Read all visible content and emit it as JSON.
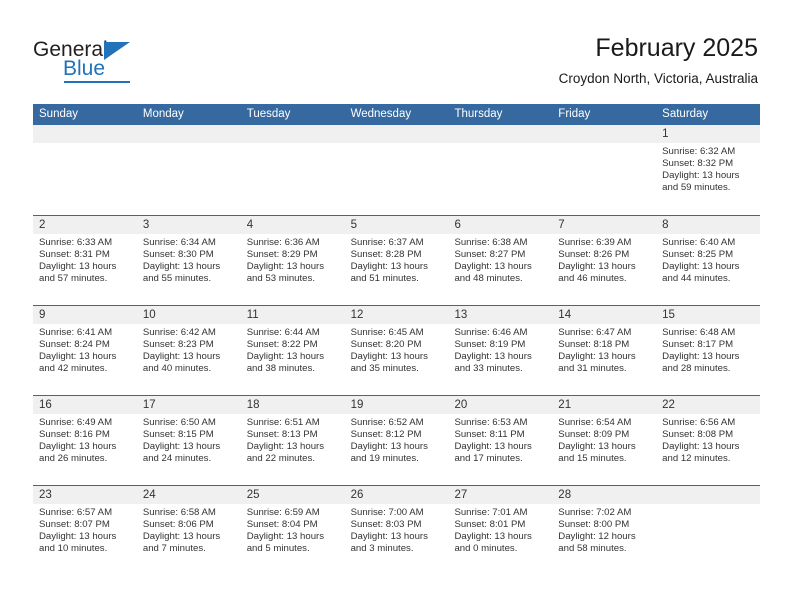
{
  "brand": {
    "name_top": "General",
    "name_bottom": "Blue",
    "accent_color": "#2272b9"
  },
  "header": {
    "title": "February 2025",
    "location": "Croydon North, Victoria, Australia"
  },
  "theme": {
    "header_bar": "#36699f",
    "day_band": "#f0f0f0",
    "text": "#333333"
  },
  "calendar": {
    "weekdays": [
      "Sunday",
      "Monday",
      "Tuesday",
      "Wednesday",
      "Thursday",
      "Friday",
      "Saturday"
    ],
    "labels": {
      "sunrise": "Sunrise:",
      "sunset": "Sunset:",
      "daylight": "Daylight:"
    },
    "weeks": [
      [
        {
          "day": ""
        },
        {
          "day": ""
        },
        {
          "day": ""
        },
        {
          "day": ""
        },
        {
          "day": ""
        },
        {
          "day": ""
        },
        {
          "day": "1",
          "sunrise": "Sunrise: 6:32 AM",
          "sunset": "Sunset: 8:32 PM",
          "daylight1": "Daylight: 13 hours",
          "daylight2": "and 59 minutes."
        }
      ],
      [
        {
          "day": "2",
          "sunrise": "Sunrise: 6:33 AM",
          "sunset": "Sunset: 8:31 PM",
          "daylight1": "Daylight: 13 hours",
          "daylight2": "and 57 minutes."
        },
        {
          "day": "3",
          "sunrise": "Sunrise: 6:34 AM",
          "sunset": "Sunset: 8:30 PM",
          "daylight1": "Daylight: 13 hours",
          "daylight2": "and 55 minutes."
        },
        {
          "day": "4",
          "sunrise": "Sunrise: 6:36 AM",
          "sunset": "Sunset: 8:29 PM",
          "daylight1": "Daylight: 13 hours",
          "daylight2": "and 53 minutes."
        },
        {
          "day": "5",
          "sunrise": "Sunrise: 6:37 AM",
          "sunset": "Sunset: 8:28 PM",
          "daylight1": "Daylight: 13 hours",
          "daylight2": "and 51 minutes."
        },
        {
          "day": "6",
          "sunrise": "Sunrise: 6:38 AM",
          "sunset": "Sunset: 8:27 PM",
          "daylight1": "Daylight: 13 hours",
          "daylight2": "and 48 minutes."
        },
        {
          "day": "7",
          "sunrise": "Sunrise: 6:39 AM",
          "sunset": "Sunset: 8:26 PM",
          "daylight1": "Daylight: 13 hours",
          "daylight2": "and 46 minutes."
        },
        {
          "day": "8",
          "sunrise": "Sunrise: 6:40 AM",
          "sunset": "Sunset: 8:25 PM",
          "daylight1": "Daylight: 13 hours",
          "daylight2": "and 44 minutes."
        }
      ],
      [
        {
          "day": "9",
          "sunrise": "Sunrise: 6:41 AM",
          "sunset": "Sunset: 8:24 PM",
          "daylight1": "Daylight: 13 hours",
          "daylight2": "and 42 minutes."
        },
        {
          "day": "10",
          "sunrise": "Sunrise: 6:42 AM",
          "sunset": "Sunset: 8:23 PM",
          "daylight1": "Daylight: 13 hours",
          "daylight2": "and 40 minutes."
        },
        {
          "day": "11",
          "sunrise": "Sunrise: 6:44 AM",
          "sunset": "Sunset: 8:22 PM",
          "daylight1": "Daylight: 13 hours",
          "daylight2": "and 38 minutes."
        },
        {
          "day": "12",
          "sunrise": "Sunrise: 6:45 AM",
          "sunset": "Sunset: 8:20 PM",
          "daylight1": "Daylight: 13 hours",
          "daylight2": "and 35 minutes."
        },
        {
          "day": "13",
          "sunrise": "Sunrise: 6:46 AM",
          "sunset": "Sunset: 8:19 PM",
          "daylight1": "Daylight: 13 hours",
          "daylight2": "and 33 minutes."
        },
        {
          "day": "14",
          "sunrise": "Sunrise: 6:47 AM",
          "sunset": "Sunset: 8:18 PM",
          "daylight1": "Daylight: 13 hours",
          "daylight2": "and 31 minutes."
        },
        {
          "day": "15",
          "sunrise": "Sunrise: 6:48 AM",
          "sunset": "Sunset: 8:17 PM",
          "daylight1": "Daylight: 13 hours",
          "daylight2": "and 28 minutes."
        }
      ],
      [
        {
          "day": "16",
          "sunrise": "Sunrise: 6:49 AM",
          "sunset": "Sunset: 8:16 PM",
          "daylight1": "Daylight: 13 hours",
          "daylight2": "and 26 minutes."
        },
        {
          "day": "17",
          "sunrise": "Sunrise: 6:50 AM",
          "sunset": "Sunset: 8:15 PM",
          "daylight1": "Daylight: 13 hours",
          "daylight2": "and 24 minutes."
        },
        {
          "day": "18",
          "sunrise": "Sunrise: 6:51 AM",
          "sunset": "Sunset: 8:13 PM",
          "daylight1": "Daylight: 13 hours",
          "daylight2": "and 22 minutes."
        },
        {
          "day": "19",
          "sunrise": "Sunrise: 6:52 AM",
          "sunset": "Sunset: 8:12 PM",
          "daylight1": "Daylight: 13 hours",
          "daylight2": "and 19 minutes."
        },
        {
          "day": "20",
          "sunrise": "Sunrise: 6:53 AM",
          "sunset": "Sunset: 8:11 PM",
          "daylight1": "Daylight: 13 hours",
          "daylight2": "and 17 minutes."
        },
        {
          "day": "21",
          "sunrise": "Sunrise: 6:54 AM",
          "sunset": "Sunset: 8:09 PM",
          "daylight1": "Daylight: 13 hours",
          "daylight2": "and 15 minutes."
        },
        {
          "day": "22",
          "sunrise": "Sunrise: 6:56 AM",
          "sunset": "Sunset: 8:08 PM",
          "daylight1": "Daylight: 13 hours",
          "daylight2": "and 12 minutes."
        }
      ],
      [
        {
          "day": "23",
          "sunrise": "Sunrise: 6:57 AM",
          "sunset": "Sunset: 8:07 PM",
          "daylight1": "Daylight: 13 hours",
          "daylight2": "and 10 minutes."
        },
        {
          "day": "24",
          "sunrise": "Sunrise: 6:58 AM",
          "sunset": "Sunset: 8:06 PM",
          "daylight1": "Daylight: 13 hours",
          "daylight2": "and 7 minutes."
        },
        {
          "day": "25",
          "sunrise": "Sunrise: 6:59 AM",
          "sunset": "Sunset: 8:04 PM",
          "daylight1": "Daylight: 13 hours",
          "daylight2": "and 5 minutes."
        },
        {
          "day": "26",
          "sunrise": "Sunrise: 7:00 AM",
          "sunset": "Sunset: 8:03 PM",
          "daylight1": "Daylight: 13 hours",
          "daylight2": "and 3 minutes."
        },
        {
          "day": "27",
          "sunrise": "Sunrise: 7:01 AM",
          "sunset": "Sunset: 8:01 PM",
          "daylight1": "Daylight: 13 hours",
          "daylight2": "and 0 minutes."
        },
        {
          "day": "28",
          "sunrise": "Sunrise: 7:02 AM",
          "sunset": "Sunset: 8:00 PM",
          "daylight1": "Daylight: 12 hours",
          "daylight2": "and 58 minutes."
        },
        {
          "day": ""
        }
      ]
    ]
  }
}
